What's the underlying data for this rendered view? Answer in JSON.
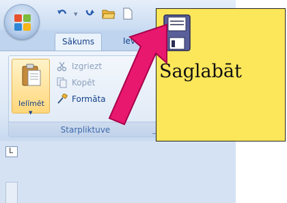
{
  "quick_access": {
    "icons": [
      "undo-icon",
      "redo-icon",
      "open-folder-icon",
      "new-document-icon"
    ]
  },
  "tabs": [
    {
      "label": "Sākums",
      "active": true
    },
    {
      "label": "Ievieto",
      "active": false
    }
  ],
  "clipboard_group": {
    "paste_label": "Ielīmēt",
    "commands": [
      {
        "label": "Izgriezt",
        "icon": "scissors-icon",
        "enabled": false
      },
      {
        "label": "Kopēt",
        "icon": "copy-icon",
        "enabled": false
      },
      {
        "label": "Formāta krāsotājs",
        "visible_label": "Formāta ",
        "icon": "format-painter-icon",
        "enabled": true
      }
    ],
    "group_label": "Starpliktuve"
  },
  "tooltip": {
    "label": "Saglabāt",
    "icon": "floppy-disk-icon",
    "background": "#fce65a"
  },
  "ruler_toggle": "L",
  "colors": {
    "ribbon": "#dbe7f5",
    "tab_text": "#15428b",
    "arrow": "#e8186f"
  }
}
